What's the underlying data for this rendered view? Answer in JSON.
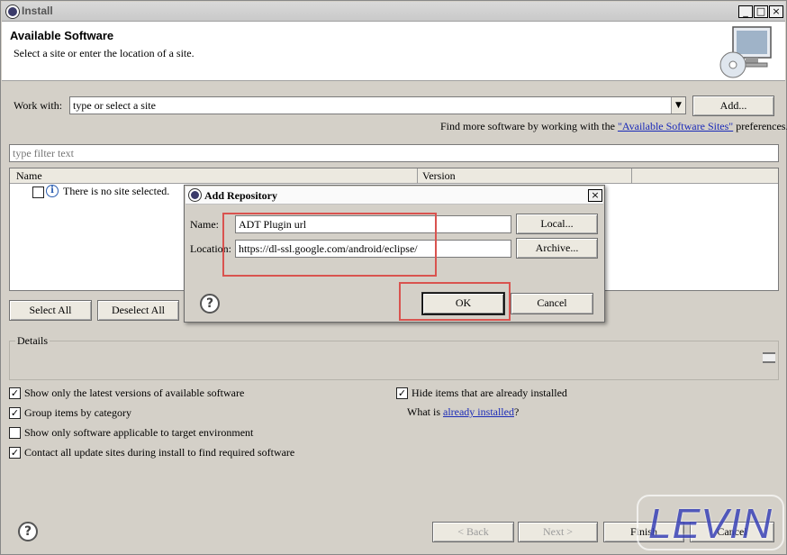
{
  "window": {
    "title": "Install",
    "controls": [
      "_",
      "□",
      "×"
    ]
  },
  "header": {
    "title": "Available Software",
    "subtitle": "Select a site or enter the location of a site."
  },
  "work_with": {
    "label": "Work with:",
    "value": "type or select a site",
    "add_button": "Add..."
  },
  "find_more": {
    "prefix": "Find more software by working with the ",
    "link": "\"Available Software Sites\"",
    "suffix": " preferences."
  },
  "filter": {
    "placeholder": "type filter text"
  },
  "tree": {
    "columns": [
      "Name",
      "Version"
    ],
    "row": "There is no site selected."
  },
  "buttons": {
    "select_all": "Select All",
    "deselect_all": "Deselect All"
  },
  "details": {
    "label": "Details"
  },
  "options": {
    "left": [
      {
        "label": "Show only the latest versions of available software",
        "checked": true
      },
      {
        "label": "Group items by category",
        "checked": true
      },
      {
        "label": "Show only software applicable to target environment",
        "checked": false
      },
      {
        "label": "Contact all update sites during install to find required software",
        "checked": true
      }
    ],
    "hide_installed": {
      "label": "Hide items that are already installed",
      "checked": true
    },
    "what_is": {
      "prefix": "What is ",
      "link": "already installed",
      "suffix": "?"
    }
  },
  "footer": {
    "back": "< Back",
    "next": "Next >",
    "finish": "Finish",
    "cancel": "Cancel"
  },
  "dialog": {
    "title": "Add Repository",
    "name_label": "Name:",
    "name_value": "ADT Plugin url",
    "location_label": "Location:",
    "location_value": "https://dl-ssl.google.com/android/eclipse/",
    "local_button": "Local...",
    "archive_button": "Archive...",
    "ok_button": "OK",
    "cancel_button": "Cancel"
  },
  "watermark": "LEVIN",
  "colors": {
    "highlight": "#d9534f",
    "link": "#1a2ab8",
    "watermark": "#3a43b8"
  }
}
